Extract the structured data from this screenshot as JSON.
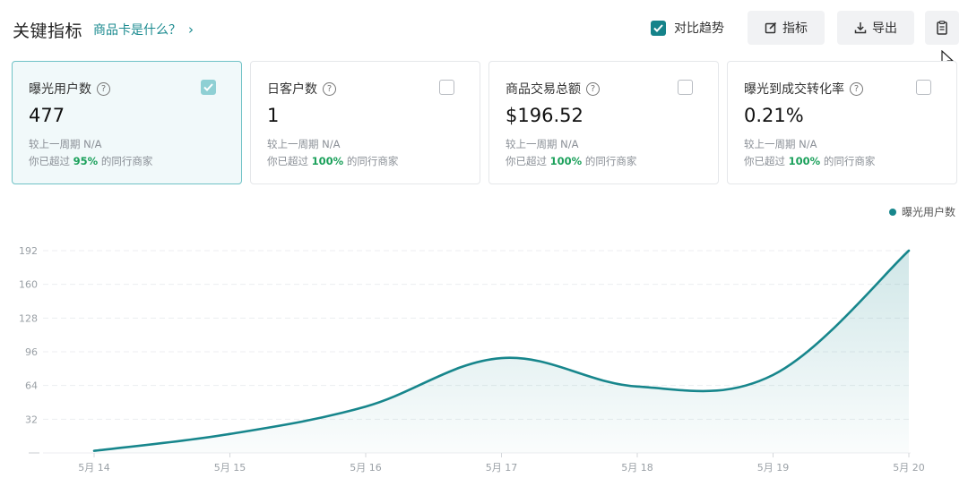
{
  "header": {
    "title": "关键指标",
    "help_link": "商品卡是什么？",
    "help_chevron": "›",
    "trend_toggle_label": "对比趋势",
    "metric_button": "指标",
    "export_button": "导出"
  },
  "cards": [
    {
      "label": "曝光用户数",
      "value": "477",
      "compare": "较上一周期 N/A",
      "exceed_prefix": "你已超过 ",
      "exceed_pct": "95%",
      "exceed_suffix": " 的同行商家",
      "selected": true
    },
    {
      "label": "日客户数",
      "value": "1",
      "compare": "较上一周期 N/A",
      "exceed_prefix": "你已超过 ",
      "exceed_pct": "100%",
      "exceed_suffix": " 的同行商家",
      "selected": false
    },
    {
      "label": "商品交易总额",
      "value": "$196.52",
      "compare": "较上一周期 N/A",
      "exceed_prefix": "你已超过 ",
      "exceed_pct": "100%",
      "exceed_suffix": " 的同行商家",
      "selected": false
    },
    {
      "label": "曝光到成交转化率",
      "value": "0.21%",
      "compare": "较上一周期 N/A",
      "exceed_prefix": "你已超过 ",
      "exceed_pct": "100%",
      "exceed_suffix": " 的同行商家",
      "selected": false
    }
  ],
  "legend": {
    "series_name": "曝光用户数",
    "color": "#17868c"
  },
  "chart_data": {
    "type": "area",
    "categories": [
      "5月 14",
      "5月 15",
      "5月 16",
      "5月 17",
      "5月 18",
      "5月 19",
      "5月 20"
    ],
    "series": [
      {
        "name": "曝光用户数",
        "values": [
          2,
          18,
          44,
          90,
          63,
          74,
          192
        ]
      }
    ],
    "y_ticks": [
      32,
      64,
      96,
      128,
      160,
      192
    ],
    "ylim": [
      0,
      192
    ],
    "grid": true,
    "legend_position": "top-right",
    "line_color": "#17868c"
  }
}
